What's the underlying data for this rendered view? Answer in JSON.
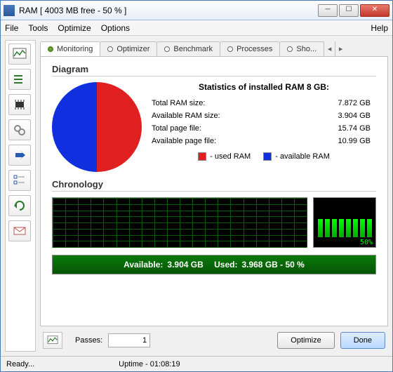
{
  "window": {
    "title": "RAM [ 4003 MB free - 50 % ]"
  },
  "menu": {
    "file": "File",
    "tools": "Tools",
    "optimize": "Optimize",
    "options": "Options",
    "help": "Help"
  },
  "tabs": {
    "monitoring": "Monitoring",
    "optimizer": "Optimizer",
    "benchmark": "Benchmark",
    "processes": "Processes",
    "shortcuts": "Sho..."
  },
  "diagram": {
    "heading": "Diagram",
    "stats_title": "Statistics of installed RAM 8 GB:",
    "total_ram_label": "Total RAM size:",
    "total_ram_value": "7.872 GB",
    "avail_ram_label": "Available RAM size:",
    "avail_ram_value": "3.904 GB",
    "total_page_label": "Total page file:",
    "total_page_value": "15.74 GB",
    "avail_page_label": "Available page file:",
    "avail_page_value": "10.99 GB",
    "legend_used": "- used RAM",
    "legend_avail": "- available RAM"
  },
  "chronology": {
    "heading": "Chronology",
    "bars_percent": "50%"
  },
  "status_strip": {
    "available_label": "Available:",
    "available_value": "3.904 GB",
    "used_label": "Used:",
    "used_value": "3.968 GB - 50 %"
  },
  "bottom": {
    "passes_label": "Passes:",
    "passes_value": "1",
    "optimize_btn": "Optimize",
    "done_btn": "Done"
  },
  "statusbar": {
    "ready": "Ready...",
    "uptime_label": "Uptime -",
    "uptime_value": "01:08:19"
  },
  "chart_data": {
    "type": "pie",
    "title": "RAM usage",
    "series": [
      {
        "name": "used RAM",
        "value": 3.968,
        "color": "#e02020"
      },
      {
        "name": "available RAM",
        "value": 3.904,
        "color": "#1030e0"
      }
    ],
    "unit": "GB"
  }
}
